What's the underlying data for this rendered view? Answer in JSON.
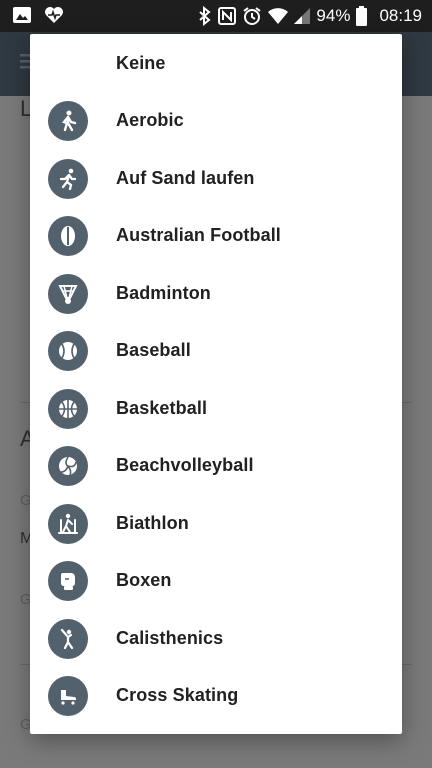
{
  "status_bar": {
    "battery": "94%",
    "time": "08:19",
    "icons": [
      "image-icon",
      "heart-pulse-icon",
      "bluetooth-icon",
      "nfc-icon",
      "alarm-icon",
      "wifi-icon",
      "signal-icon",
      "battery-icon"
    ]
  },
  "background": {
    "letter_top": "L",
    "letter_mid": "A",
    "row1_small": "G",
    "row1_value": "M",
    "row2_small": "G",
    "row3_small": "G"
  },
  "dialog": {
    "items": [
      {
        "label": "Keine",
        "icon": null
      },
      {
        "label": "Aerobic",
        "icon": "aerobic-icon"
      },
      {
        "label": "Auf Sand laufen",
        "icon": "running-icon"
      },
      {
        "label": "Australian Football",
        "icon": "football-icon"
      },
      {
        "label": "Badminton",
        "icon": "shuttlecock-icon"
      },
      {
        "label": "Baseball",
        "icon": "baseball-icon"
      },
      {
        "label": "Basketball",
        "icon": "basketball-icon"
      },
      {
        "label": "Beachvolleyball",
        "icon": "volleyball-icon"
      },
      {
        "label": "Biathlon",
        "icon": "biathlon-icon"
      },
      {
        "label": "Boxen",
        "icon": "boxing-glove-icon"
      },
      {
        "label": "Calisthenics",
        "icon": "calisthenics-icon"
      },
      {
        "label": "Cross Skating",
        "icon": "skate-icon"
      }
    ]
  },
  "colors": {
    "icon_circle": "#53616d",
    "dialog_bg": "#ffffff",
    "scrim": "#7a7a7a",
    "status_bar": "#1e1e1e"
  }
}
